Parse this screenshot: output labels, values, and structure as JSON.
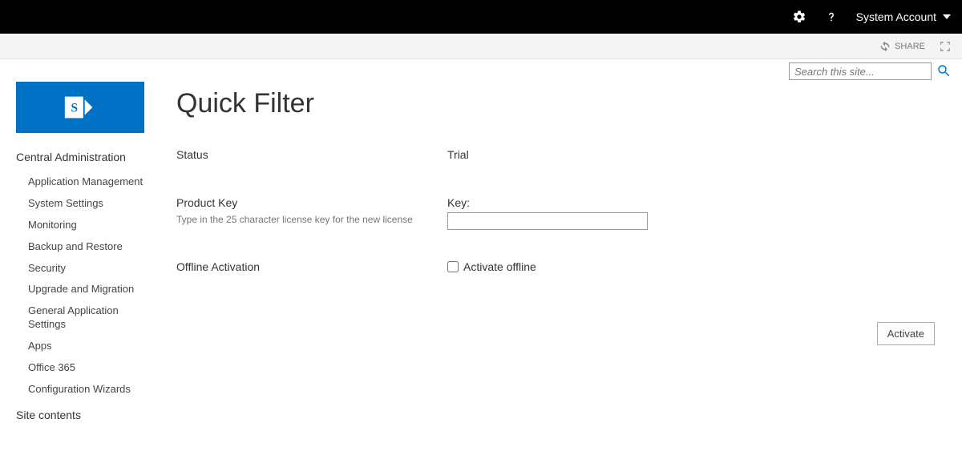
{
  "topbar": {
    "user_label": "System Account",
    "gear_icon": "gear-icon",
    "help_icon": "help-icon"
  },
  "ribbon": {
    "share_label": "SHARE"
  },
  "search": {
    "placeholder": "Search this site..."
  },
  "page_title": "Quick Filter",
  "nav_heading": "Central Administration",
  "nav_items": [
    "Application Management",
    "System Settings",
    "Monitoring",
    "Backup and Restore",
    "Security",
    "Upgrade and Migration",
    "General Application Settings",
    "Apps",
    "Office 365",
    "Configuration Wizards"
  ],
  "nav_bottom": "Site contents",
  "form": {
    "status_label": "Status",
    "status_value": "Trial",
    "product_key_label": "Product Key",
    "product_key_desc": "Type in the 25 character license key for the new license",
    "key_field_label": "Key:",
    "key_value": "",
    "offline_label": "Offline Activation",
    "offline_checkbox_label": "Activate offline",
    "offline_checked": false,
    "activate_button_label": "Activate"
  }
}
